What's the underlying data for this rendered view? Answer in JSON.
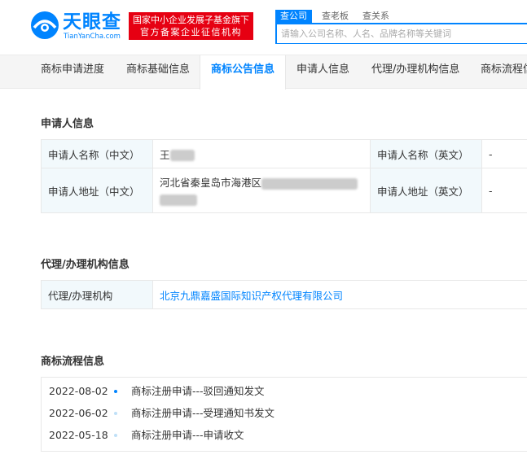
{
  "header": {
    "logo_cn": "天眼查",
    "logo_en": "TianYanCha.com",
    "badge_line1": "国家中小企业发展子基金旗下",
    "badge_line2": "官方备案企业征信机构",
    "search_tabs": [
      "查公司",
      "查老板",
      "查关系"
    ],
    "search_placeholder": "请输入公司名称、人名、品牌名称等关键词"
  },
  "nav_tabs": [
    "商标申请进度",
    "商标基础信息",
    "商标公告信息",
    "申请人信息",
    "代理/办理机构信息",
    "商标流程信"
  ],
  "applicant": {
    "title": "申请人信息",
    "name_cn_label": "申请人名称（中文）",
    "name_cn_value": "王",
    "name_en_label": "申请人名称（英文）",
    "name_en_value": "-",
    "addr_cn_label": "申请人地址（中文）",
    "addr_cn_value": "河北省秦皇岛市海港区",
    "addr_en_label": "申请人地址（英文）",
    "addr_en_value": "-"
  },
  "agency": {
    "title": "代理/办理机构信息",
    "label": "代理/办理机构",
    "value": "北京九鼎嘉盛国际知识产权代理有限公司"
  },
  "flow": {
    "title": "商标流程信息",
    "items": [
      {
        "date": "2022-08-02",
        "text": "商标注册申请---驳回通知发文"
      },
      {
        "date": "2022-06-02",
        "text": "商标注册申请---受理通知书发文"
      },
      {
        "date": "2022-05-18",
        "text": "商标注册申请---申请收文"
      }
    ]
  },
  "colors": {
    "brand": "#0084ff",
    "badge": "#e60012",
    "label_bg": "#f2f9fc"
  }
}
